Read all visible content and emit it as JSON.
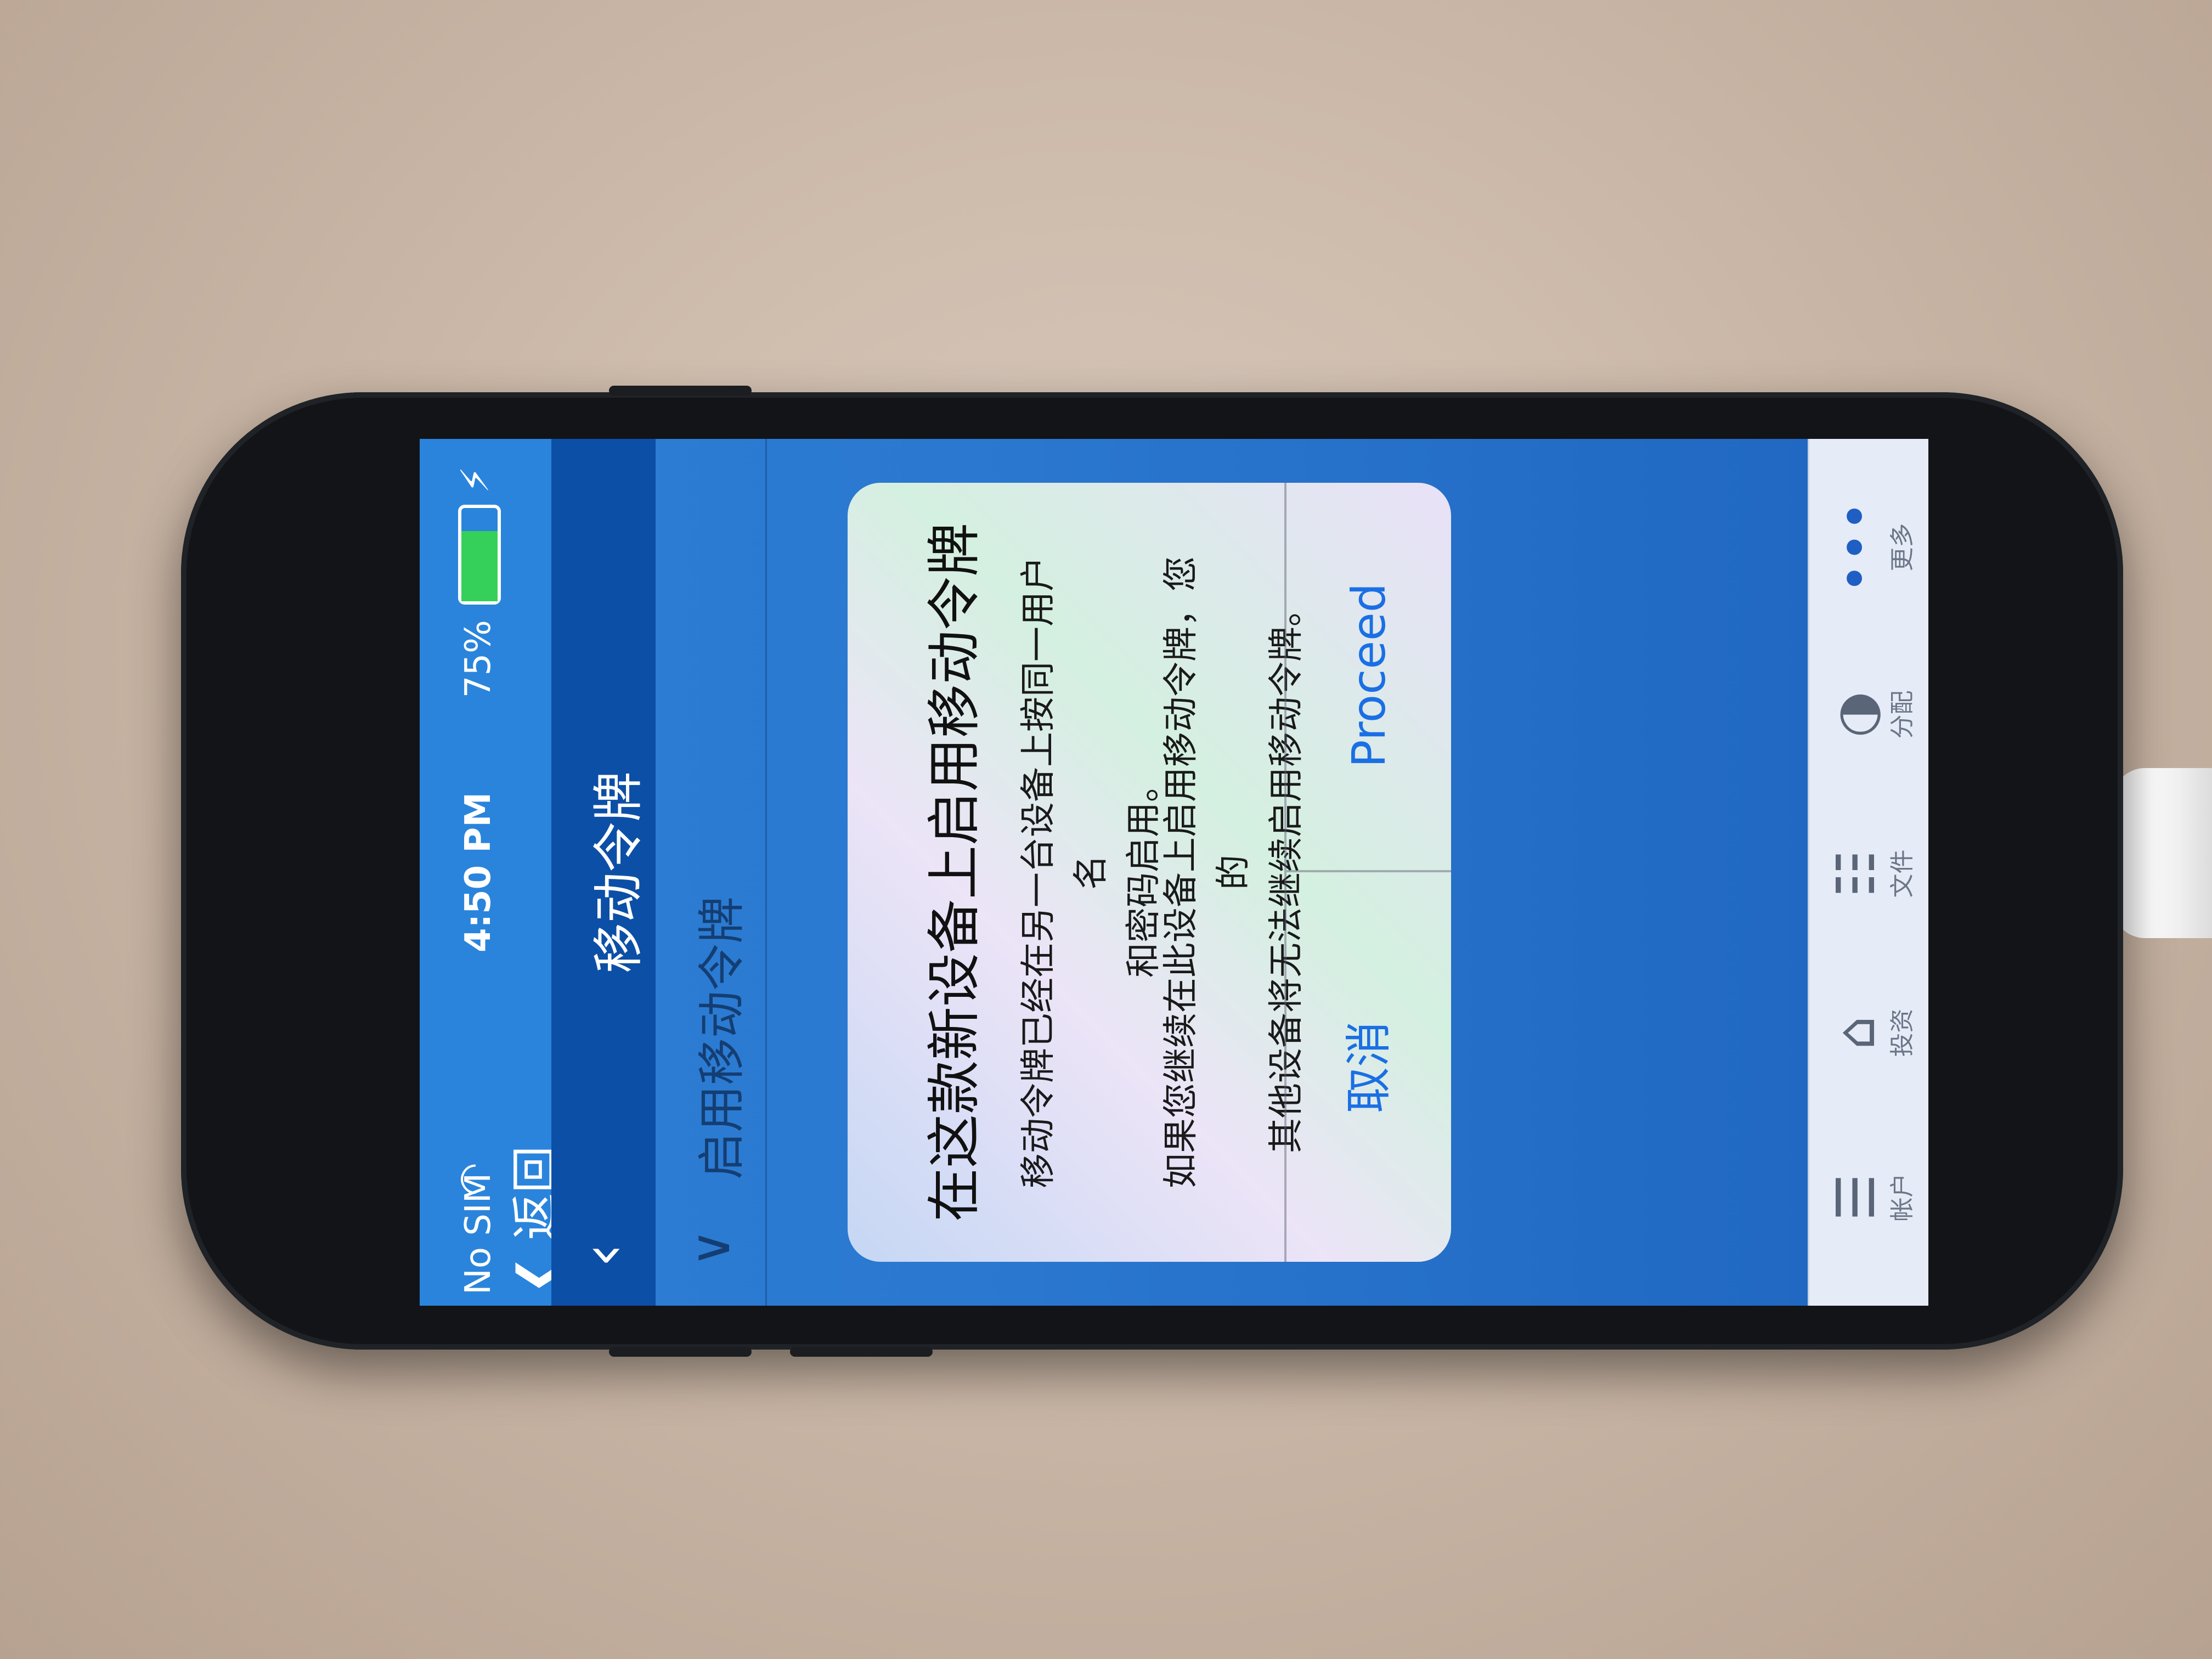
{
  "status_bar": {
    "carrier": "No SIM",
    "time": "4:50 PM",
    "battery_percent": "75%",
    "battery_level": 0.75,
    "back_label": "返回"
  },
  "nav_bar": {
    "title": "移动令牌"
  },
  "section": {
    "label": "启用移动令牌"
  },
  "dialog": {
    "title": "在这款新设备上启用移动令牌",
    "message_line1": "移动令牌已经在另一台设备上按同一用户名",
    "message_line2": "和密码启用。",
    "message2_line1": "如果您继续在此设备上启用移动令牌，您的",
    "message2_line2": "其他设备将无法继续启用移动令牌。",
    "cancel_label": "取消",
    "proceed_label": "Proceed"
  },
  "tab_bar": {
    "items": [
      {
        "label": "帐户",
        "icon": "coins-stack-icon"
      },
      {
        "label": "投资",
        "icon": "bank-building-icon"
      },
      {
        "label": "文件",
        "icon": "document-icon"
      },
      {
        "label": "分配",
        "icon": "globe-icon"
      },
      {
        "label": "更多",
        "icon": "more-dots-icon"
      }
    ]
  },
  "colors": {
    "status_bar": "#2a84dc",
    "nav_bar": "#0c4fa6",
    "link_blue": "#1a6fe4",
    "battery_green": "#35d05a"
  }
}
